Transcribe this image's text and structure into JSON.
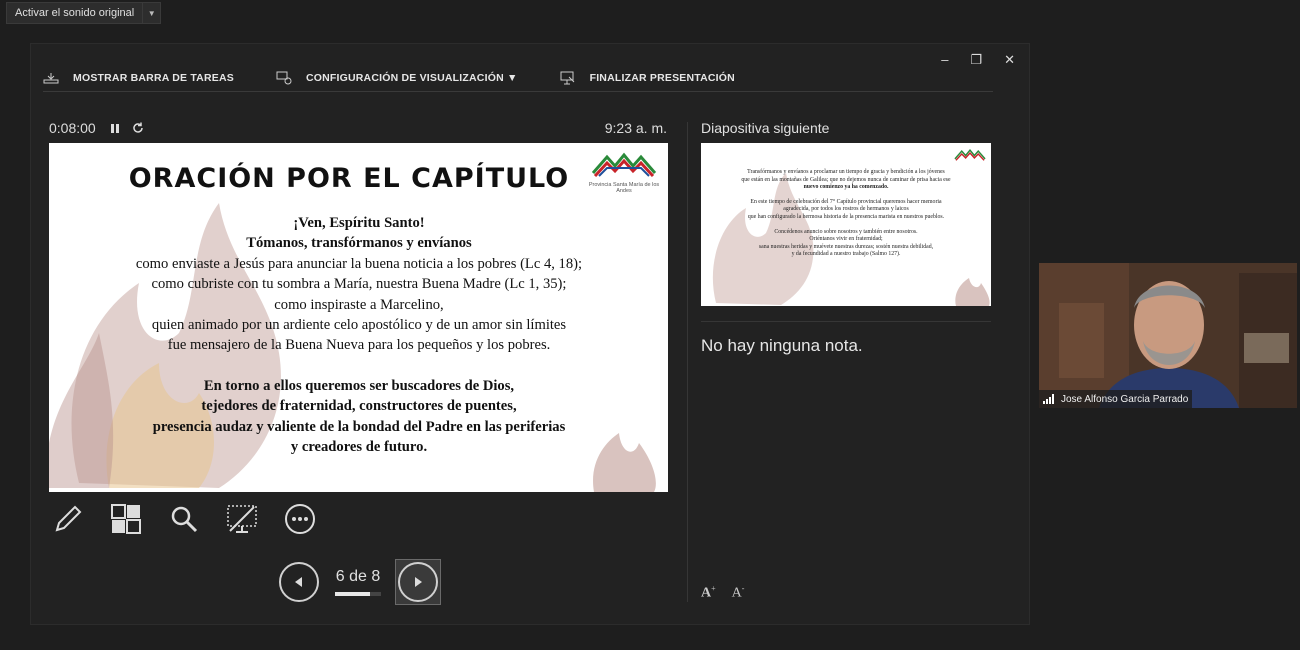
{
  "audio": {
    "label": "Activar el sonido original"
  },
  "window_controls": {
    "minimize": "–",
    "restore": "❐",
    "close": "✕"
  },
  "toolbar": {
    "taskbar": "MOSTRAR BARRA DE TAREAS",
    "display": "CONFIGURACIÓN DE VISUALIZACIÓN ▼",
    "end": "FINALIZAR PRESENTACIÓN"
  },
  "timer": {
    "elapsed": "0:08:00",
    "clock": "9:23 a. m."
  },
  "slide": {
    "title": "ORACIÓN POR EL CAPÍTULO",
    "logo_caption": "Provincia Santa María de los Andes",
    "lines": [
      "¡Ven, Espíritu Santo!",
      "Tómanos, transfórmanos y envíanos",
      "como enviaste a Jesús para anunciar la buena noticia a los pobres (Lc 4, 18);",
      "como cubriste con tu sombra a María, nuestra Buena Madre (Lc 1, 35);",
      "como inspiraste a Marcelino,",
      "quien animado por un ardiente celo apostólico y de un amor sin límites",
      "fue mensajero de la Buena Nueva para los pequeños y los pobres.",
      "En torno a ellos queremos ser buscadores de Dios,",
      "tejedores de fraternidad, constructores de puentes,",
      "presencia audaz y valiente de la bondad del Padre en las periferias",
      "y creadores de futuro."
    ]
  },
  "nav": {
    "counter": "6 de 8",
    "progress": 0.75
  },
  "next": {
    "label": "Diapositiva siguiente",
    "lines": [
      "Transfórmanos y envíanos a proclamar un tiempo de gracia y bendición a los jóvenes",
      "que están en las montañas de Galilea; que no dejemos nunca de caminar de prisa hacia ese",
      "nuevo comienzo ya ha comenzado.",
      "En este tiempo de celebración del 7° Capítulo provincial queremos hacer memoria",
      "agradecida, por todos los rostros de hermanos y laicos",
      "que han configurado la hermosa historia de la presencia marista en nuestros pueblos.",
      "Concédenos anuncio sobre nosotros y también entre nosotros.",
      "Oriéntanos vivir en fraternidad;",
      "sana nuestras heridas y muévete nuestras durezas; sostén nuestra debilidad,",
      "y da fecundidad a nuestro trabajo (Salmo 127)."
    ]
  },
  "notes": {
    "text": "No hay ninguna nota."
  },
  "video": {
    "name": "Jose Alfonso Garcia Parrado"
  },
  "colors": {
    "background": "#1e1e1e",
    "panel": "#222222",
    "flame": "#c9a9a4"
  }
}
